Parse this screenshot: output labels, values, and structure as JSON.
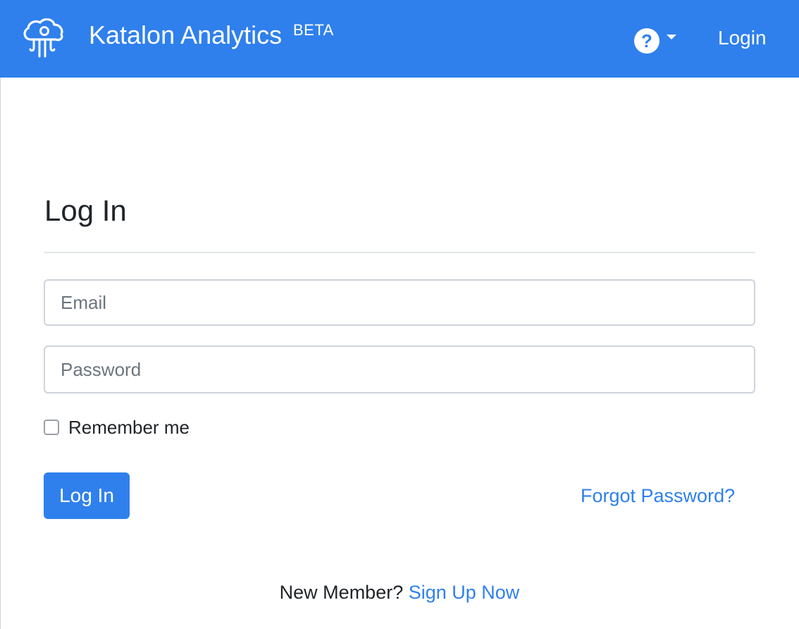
{
  "header": {
    "brand_name": "Katalon Analytics",
    "brand_badge": "BETA",
    "help_symbol": "?",
    "login_link": "Login",
    "icons": [
      "jellyfish-cloud-logo-icon",
      "help-icon",
      "caret-down-icon"
    ]
  },
  "form": {
    "title": "Log In",
    "email_placeholder": "Email",
    "password_placeholder": "Password",
    "remember_label": "Remember me",
    "remember_checked": false,
    "submit_label": "Log In",
    "forgot_link": "Forgot Password?"
  },
  "signup": {
    "prompt": "New Member?",
    "link": "Sign Up Now"
  },
  "colors": {
    "brand": "#2f80ed",
    "text": "#212529",
    "border": "#ced4da"
  }
}
